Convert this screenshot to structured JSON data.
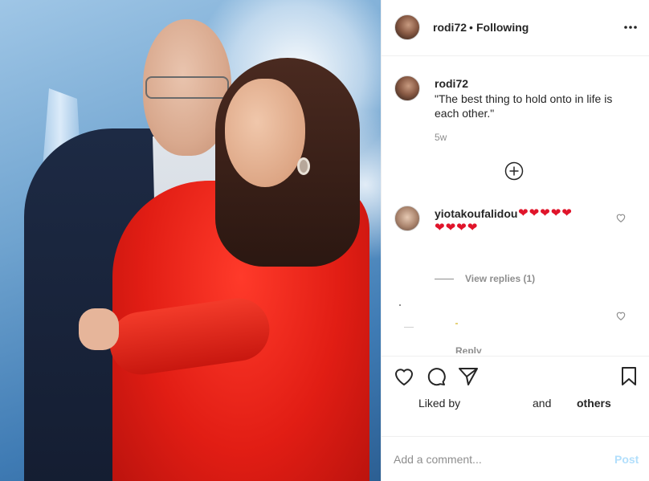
{
  "post": {
    "username": "rodi72",
    "separator": "•",
    "follow_status": "Following",
    "caption": "\"The best thing to hold onto in life is each other.\"",
    "time_ago": "5w"
  },
  "comments": [
    {
      "username": "yiotakoufalidou",
      "hearts_line1": "❤❤❤❤❤",
      "hearts_line2": "❤❤❤❤"
    }
  ],
  "view_replies": "View replies (1)",
  "reply_label": "Reply",
  "likes": {
    "liked_by": "Liked by",
    "and": "and",
    "others": "others"
  },
  "add_comment": {
    "placeholder": "Add a comment...",
    "post_label": "Post"
  },
  "icons": {
    "more": "more-options-icon",
    "load_more": "plus-circle-icon",
    "like": "heart-outline-icon",
    "comment": "comment-bubble-icon",
    "share": "paper-plane-icon",
    "save": "bookmark-icon"
  },
  "colors": {
    "post_button": "#b2dffc",
    "hearts": "#e0142a",
    "secondary_text": "#8e8e8e"
  }
}
